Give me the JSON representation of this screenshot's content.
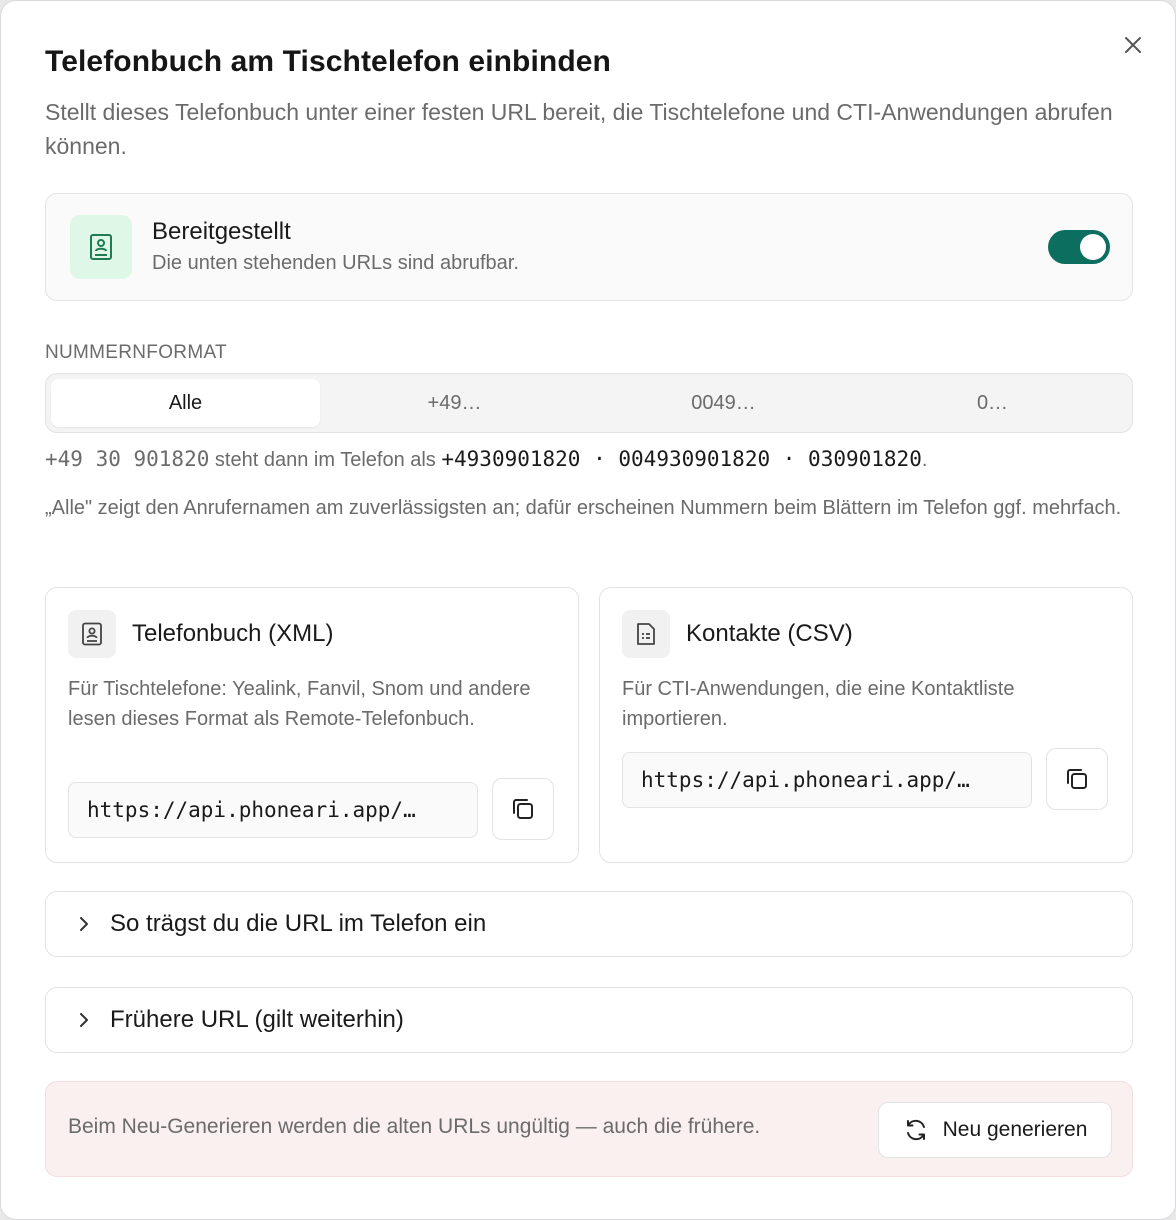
{
  "dialog": {
    "title": "Telefonbuch am Tischtelefon einbinden",
    "subtitle": "Stellt dieses Telefonbuch unter einer festen URL bereit, die Tischtelefone und CTI-Anwendungen abrufen können.",
    "close_icon": "close-icon"
  },
  "provisioning": {
    "title": "Bereitgestellt",
    "description": "Die unten stehenden URLs sind abrufbar.",
    "icon": "phonebook-icon",
    "enabled": true,
    "accent_color": "#0c6e5e",
    "icon_bg": "#def7e7"
  },
  "number_format": {
    "label": "NUMMERNFORMAT",
    "options": [
      "Alle",
      "+49…",
      "0049…",
      "0…"
    ],
    "selected": "Alle",
    "example": {
      "input": "+49 30 901820",
      "connector": " steht dann im Telefon als ",
      "result_1": "+4930901820",
      "separator_1": " · ",
      "result_2": "004930901820",
      "separator_2": " · ",
      "result_3": "030901820",
      "end": "."
    },
    "hint": "„Alle\" zeigt den Anrufernamen am zuverlässigsten an; dafür erscheinen Nummern beim Blättern im Telefon ggf. mehrfach."
  },
  "cards": {
    "xml": {
      "title": "Telefonbuch (XML)",
      "description": "Für Tischtelefone: Yealink, Fanvil, Snom und andere lesen dieses Format als Remote-Telefonbuch.",
      "url": "https://api.phoneari.app/…",
      "icon": "phonebook-icon"
    },
    "csv": {
      "title": "Kontakte (CSV)",
      "description": "Für CTI-Anwendungen, die eine Kontaktliste importieren.",
      "url": "https://api.phoneari.app/…",
      "icon": "document-icon"
    }
  },
  "accordions": {
    "howto": "So trägst du die URL im Telefon ein",
    "previous": "Frühere URL (gilt weiterhin)"
  },
  "danger": {
    "text": "Beim Neu-Generieren werden die alten URLs ungültig — auch die frühere.",
    "button": "Neu generieren",
    "bg_color": "#fbf0f0"
  }
}
